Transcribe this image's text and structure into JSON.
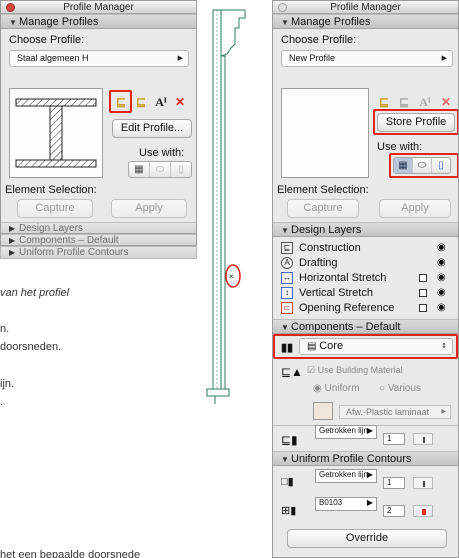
{
  "left_panel": {
    "title": "Profile Manager",
    "manage_header": "Manage Profiles",
    "choose_label": "Choose Profile:",
    "profile_value": "Staal algemeen H",
    "edit_button": "Edit Profile...",
    "use_with_label": "Use with:",
    "element_selection_label": "Element Selection:",
    "capture_button": "Capture",
    "apply_button": "Apply",
    "collapsed_sections": [
      "Design Layers",
      "Components – Default",
      "Uniform Profile Contours"
    ]
  },
  "doc_text": {
    "line1": "van het profiel",
    "line2": "n.",
    "line3": "doorsneden.",
    "line4": "ijn.",
    "line5": ".",
    "line6": "het een bepaalde doorsnede"
  },
  "right_panel": {
    "title": "Profile Manager",
    "manage_header": "Manage Profiles",
    "choose_label": "Choose Profile:",
    "profile_value": "New Profile",
    "store_button": "Store Profile",
    "use_with_label": "Use with:",
    "element_selection_label": "Element Selection:",
    "capture_button": "Capture",
    "apply_button": "Apply",
    "design_layers_header": "Design Layers",
    "layers": [
      {
        "name": "Construction",
        "icon": "construction-layer-icon",
        "has_checkbox": false
      },
      {
        "name": "Drafting",
        "icon": "drafting-layer-icon",
        "has_checkbox": false
      },
      {
        "name": "Horizontal Stretch",
        "icon": "horizontal-stretch-icon",
        "has_checkbox": true
      },
      {
        "name": "Vertical Stretch",
        "icon": "vertical-stretch-icon",
        "has_checkbox": true
      },
      {
        "name": "Opening Reference",
        "icon": "opening-reference-icon",
        "has_checkbox": true
      }
    ],
    "components_header": "Components – Default",
    "component_value": "Core",
    "use_building_material": "Use Building Material",
    "uniform_label": "Uniform",
    "various_label": "Various",
    "material_value": "Afw.-Plastic laminaat",
    "line_type_1": "Getrokken lijn",
    "pen_1": "1",
    "uniform_contours_header": "Uniform Profile Contours",
    "line_type_2": "Getrokken lijn",
    "pen_2": "1",
    "line_type_3": "B0103",
    "pen_3": "2",
    "override_button": "Override"
  },
  "colors": {
    "highlight": "#e2231a",
    "panel_bg": "#e9e9e9",
    "profile_fill": "#ffffff",
    "stretch_icon": "#c9a226"
  }
}
